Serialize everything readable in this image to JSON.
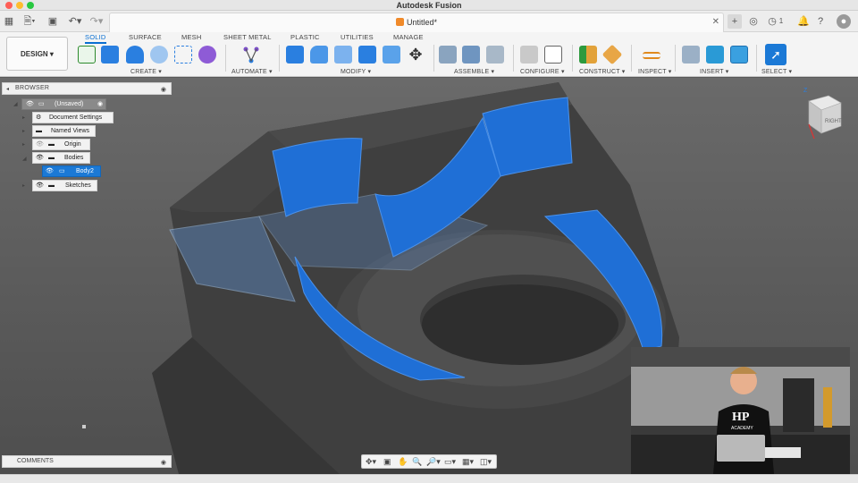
{
  "app": {
    "title": "Autodesk Fusion"
  },
  "document": {
    "tab_title": "Untitled*",
    "notifications_count": "1"
  },
  "toolbar": {
    "workspace": "DESIGN",
    "tabs": [
      {
        "label": "SOLID",
        "active": true
      },
      {
        "label": "SURFACE",
        "active": false
      },
      {
        "label": "MESH",
        "active": false
      },
      {
        "label": "SHEET METAL",
        "active": false
      },
      {
        "label": "PLASTIC",
        "active": false
      },
      {
        "label": "UTILITIES",
        "active": false
      },
      {
        "label": "MANAGE",
        "active": false
      }
    ],
    "groups": [
      {
        "label": "CREATE"
      },
      {
        "label": "AUTOMATE"
      },
      {
        "label": "MODIFY"
      },
      {
        "label": "ASSEMBLE"
      },
      {
        "label": "CONFIGURE"
      },
      {
        "label": "CONSTRUCT"
      },
      {
        "label": "INSPECT"
      },
      {
        "label": "INSERT"
      },
      {
        "label": "SELECT"
      }
    ]
  },
  "browser": {
    "header": "BROWSER",
    "root": "(Unsaved)",
    "items": [
      {
        "label": "Document Settings"
      },
      {
        "label": "Named Views"
      },
      {
        "label": "Origin"
      },
      {
        "label": "Bodies"
      },
      {
        "label": "Body2"
      },
      {
        "label": "Sketches"
      }
    ]
  },
  "comments": {
    "header": "COMMENTS"
  },
  "viewcube": {
    "face_label": "RIGHT",
    "axis_label": "Z"
  },
  "webcam": {
    "shirt_text": "HP",
    "shirt_subtext": "ACADEMY"
  },
  "colors": {
    "accent": "#0a6fd1",
    "selected_face": "#1f6fd6",
    "body": "#3b3b3b"
  },
  "icons": {
    "grid": "grid-icon",
    "file": "file-icon",
    "save": "save-icon",
    "undo": "undo-icon",
    "redo": "redo-icon",
    "add_tab": "plus-icon",
    "extensions": "extensions-icon",
    "job_status": "clock-icon",
    "bell": "bell-icon",
    "help": "help-icon",
    "profile": "profile-icon"
  }
}
